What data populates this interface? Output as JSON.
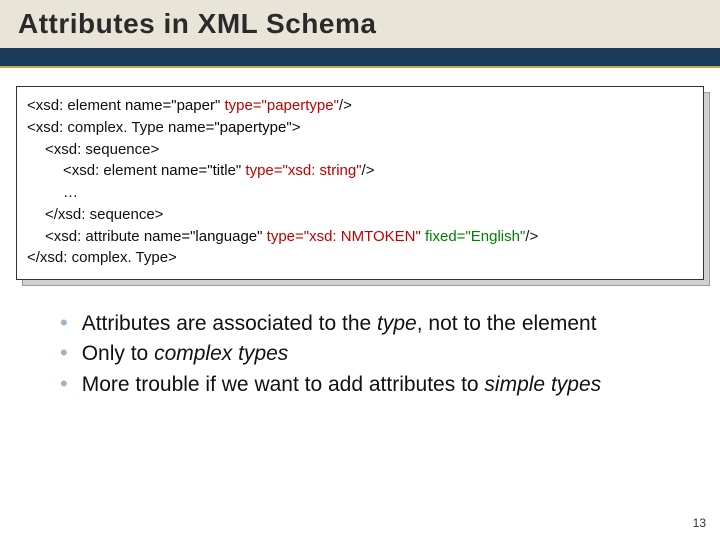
{
  "title": "Attributes in XML Schema",
  "code": {
    "l1a": "<xsd: element ",
    "l1_name": "name=\"paper\"",
    "l1_sp": " ",
    "l1_type": "type=\"papertype\"",
    "l1b": "/>",
    "l2a": "<xsd: complex. Type ",
    "l2_name": "name=\"papertype\"",
    "l2b": ">",
    "l3": "<xsd: sequence>",
    "l4a": "<xsd: element ",
    "l4_name": "name=\"title\"",
    "l4_sp": " ",
    "l4_type": "type=\"xsd: string\"",
    "l4b": "/>",
    "l5": "…",
    "l6": "</xsd: sequence>",
    "l7a": "<xsd: attribute ",
    "l7_name": "name=\"language\"",
    "l7_sp1": " ",
    "l7_type": "type=\"xsd: NMTOKEN\"",
    "l7_sp2": " ",
    "l7_fixed": "fixed=\"English\"",
    "l7b": "/>",
    "l8": "</xsd: complex. Type>"
  },
  "bullets": {
    "b1a": "Attributes are associated to the ",
    "b1i": "type",
    "b1b": ", not to the element",
    "b2a": "Only to ",
    "b2i": "complex types",
    "b3a": "More trouble if we want to add attributes to ",
    "b3i": "simple types"
  },
  "page": "13"
}
